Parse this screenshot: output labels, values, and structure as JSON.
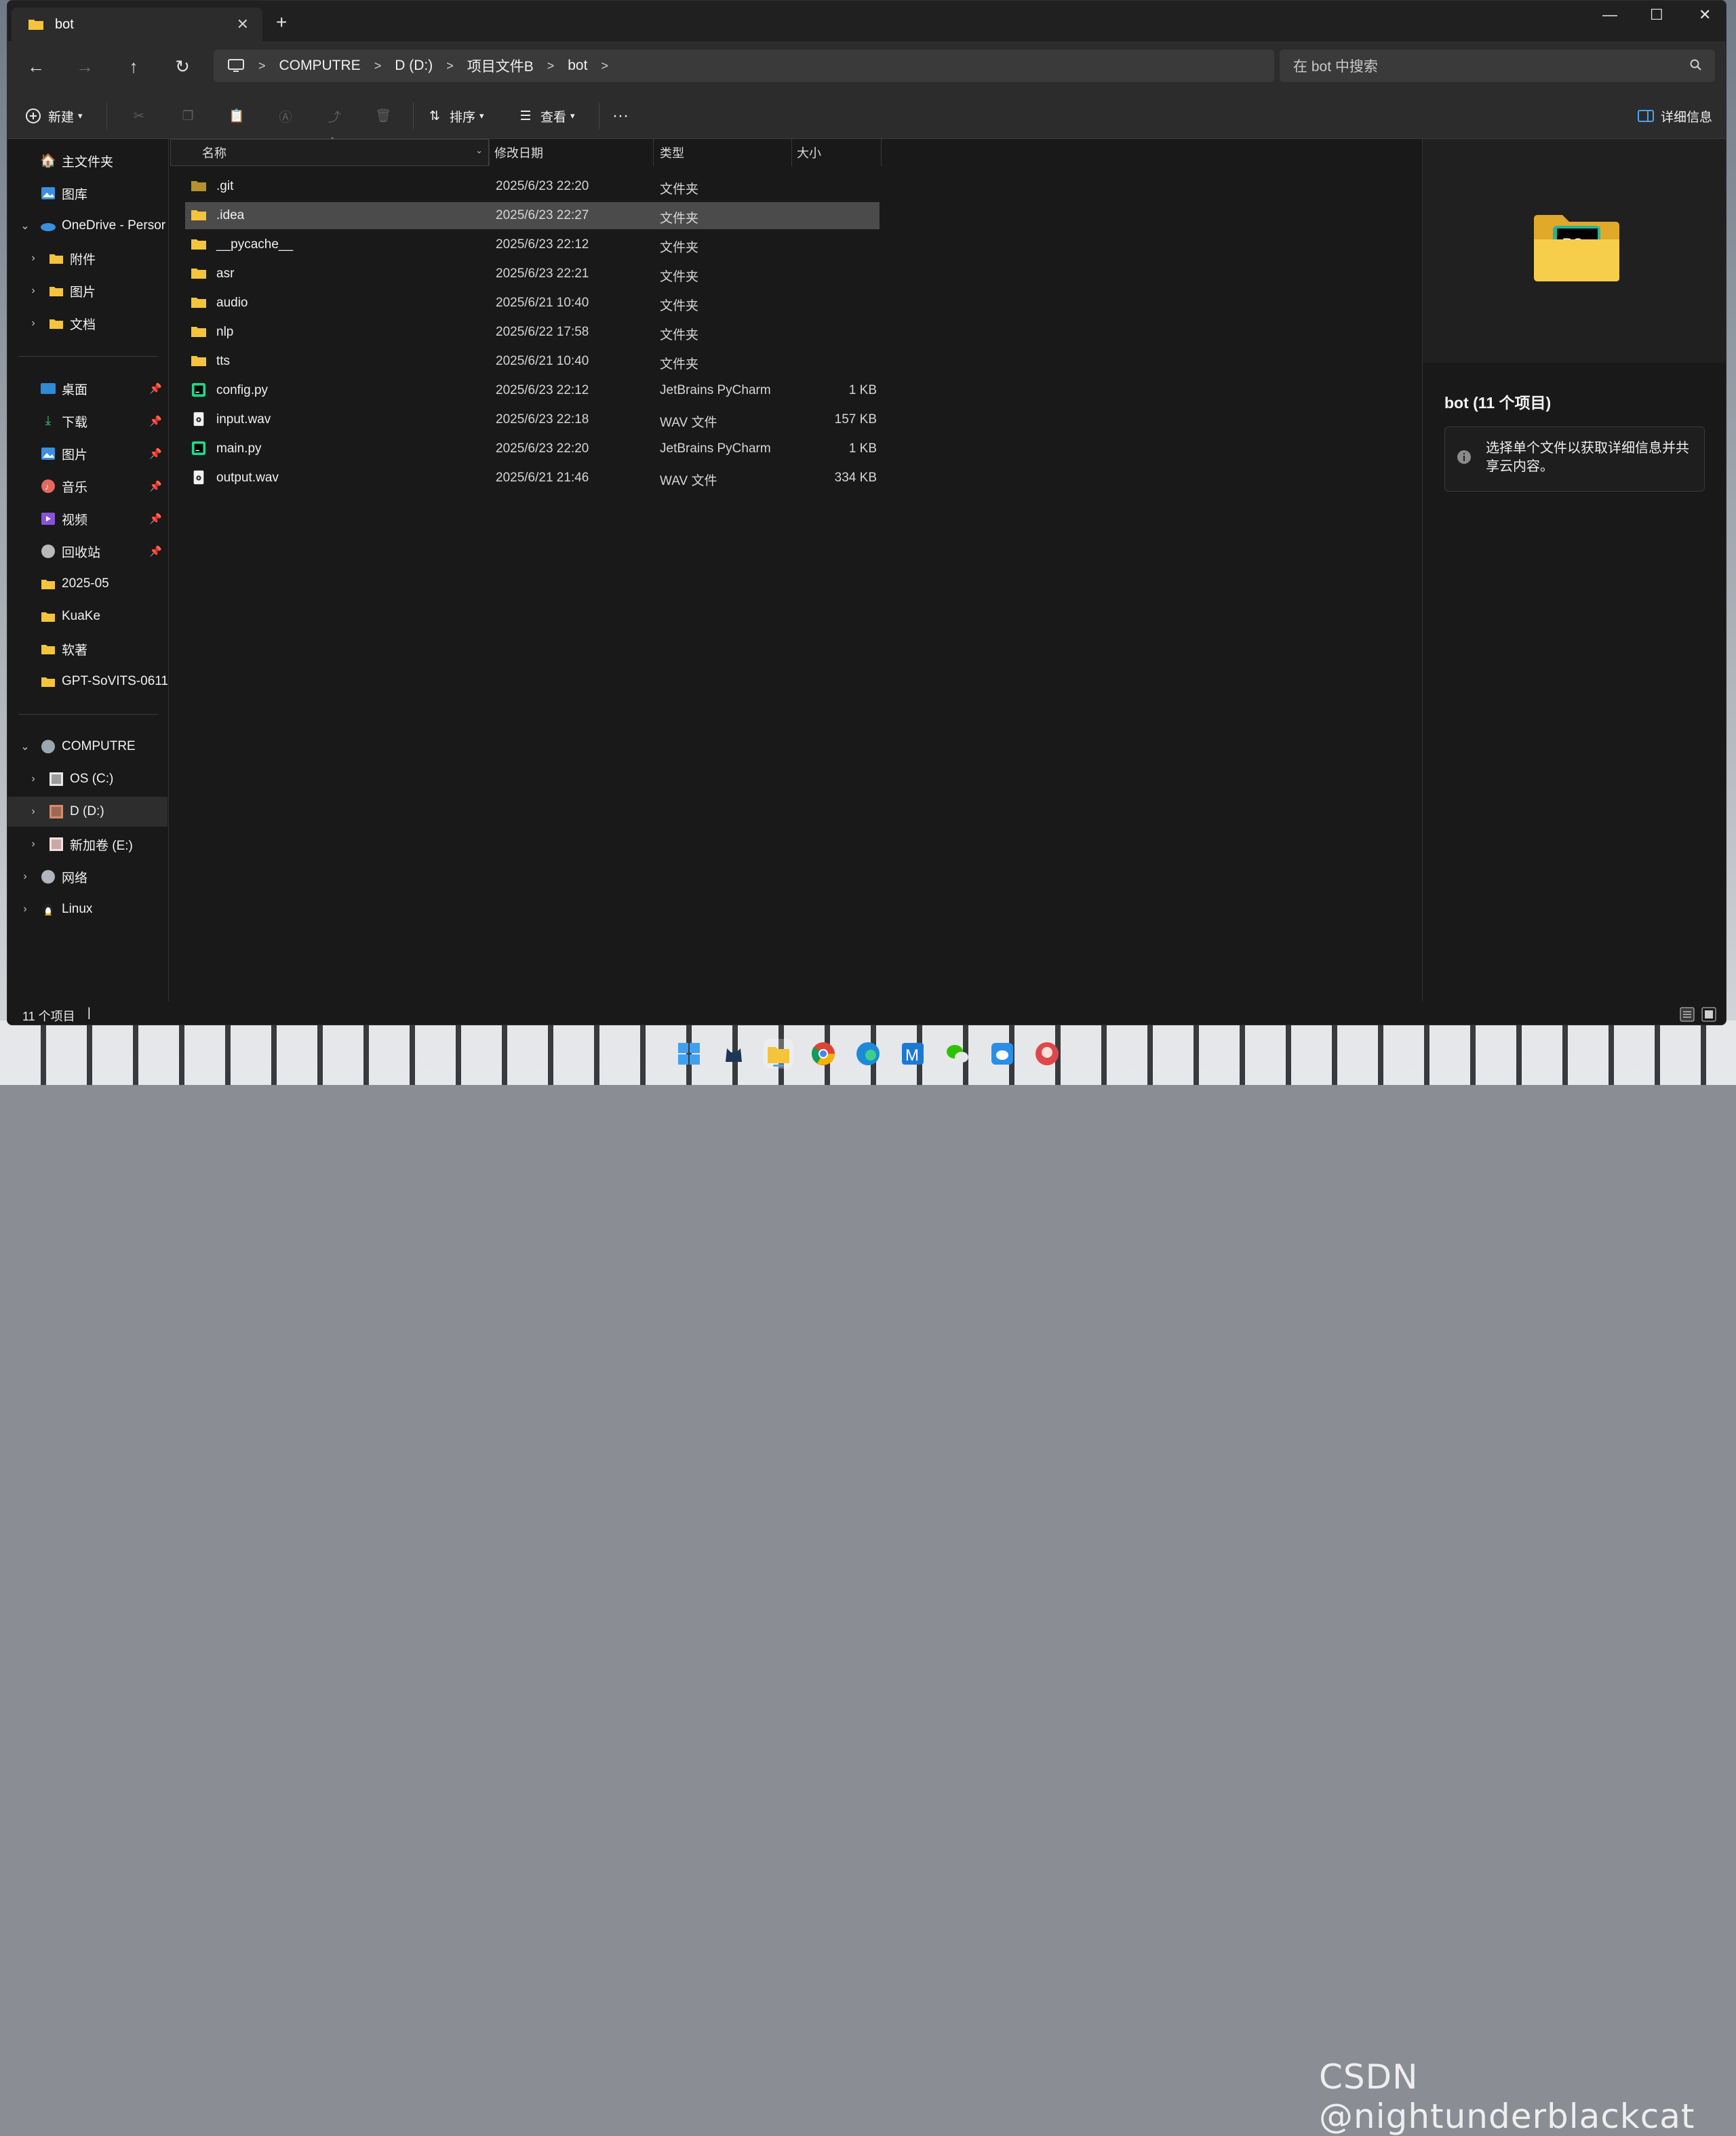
{
  "tab": {
    "title": "bot",
    "close": "✕",
    "new": "+"
  },
  "window_controls": {
    "minimize": "—",
    "maximize": "☐",
    "close": "✕"
  },
  "nav": {
    "back": "←",
    "forward": "→",
    "up": "↑",
    "refresh": "↻"
  },
  "breadcrumb": [
    "COMPUTRE",
    "D (D:)",
    "项目文件B",
    "bot"
  ],
  "search": {
    "placeholder": "在 bot 中搜索"
  },
  "toolbar": {
    "new_label": "新建",
    "sort_label": "排序",
    "view_label": "查看",
    "more": "···",
    "details_label": "详细信息"
  },
  "sidebar": {
    "home": "主文件夹",
    "gallery": "图库",
    "onedrive": "OneDrive - Persor",
    "onedrive_children": [
      "附件",
      "图片",
      "文档"
    ],
    "quick": [
      {
        "label": "桌面",
        "icon": "desktop-icon",
        "pinned": true
      },
      {
        "label": "下载",
        "icon": "download-icon",
        "pinned": true
      },
      {
        "label": "图片",
        "icon": "pictures-icon",
        "pinned": true
      },
      {
        "label": "音乐",
        "icon": "music-icon",
        "pinned": true
      },
      {
        "label": "视频",
        "icon": "video-icon",
        "pinned": true
      },
      {
        "label": "回收站",
        "icon": "recycle-bin-icon",
        "pinned": true
      },
      {
        "label": "2025-05",
        "icon": "folder-icon",
        "pinned": false
      },
      {
        "label": "KuaKe",
        "icon": "folder-icon",
        "pinned": false
      },
      {
        "label": "软著",
        "icon": "folder-icon",
        "pinned": false
      },
      {
        "label": "GPT-SoVITS-0611",
        "icon": "folder-icon",
        "pinned": false
      }
    ],
    "computer": "COMPUTRE",
    "drives": [
      "OS (C:)",
      "D (D:)",
      "新加卷 (E:)"
    ],
    "network": "网络",
    "linux": "Linux"
  },
  "columns": {
    "name": "名称",
    "date": "修改日期",
    "type": "类型",
    "size": "大小"
  },
  "files": [
    {
      "name": ".git",
      "date": "2025/6/23 22:20",
      "type": "文件夹",
      "size": "",
      "kind": "folder-dim"
    },
    {
      "name": ".idea",
      "date": "2025/6/23 22:27",
      "type": "文件夹",
      "size": "",
      "kind": "folder"
    },
    {
      "name": "__pycache__",
      "date": "2025/6/23 22:12",
      "type": "文件夹",
      "size": "",
      "kind": "folder"
    },
    {
      "name": "asr",
      "date": "2025/6/23 22:21",
      "type": "文件夹",
      "size": "",
      "kind": "folder"
    },
    {
      "name": "audio",
      "date": "2025/6/21 10:40",
      "type": "文件夹",
      "size": "",
      "kind": "folder"
    },
    {
      "name": "nlp",
      "date": "2025/6/22 17:58",
      "type": "文件夹",
      "size": "",
      "kind": "folder"
    },
    {
      "name": "tts",
      "date": "2025/6/21 10:40",
      "type": "文件夹",
      "size": "",
      "kind": "folder"
    },
    {
      "name": "config.py",
      "date": "2025/6/23 22:12",
      "type": "JetBrains PyCharm",
      "size": "1 KB",
      "kind": "pycharm"
    },
    {
      "name": "input.wav",
      "date": "2025/6/23 22:18",
      "type": "WAV 文件",
      "size": "157 KB",
      "kind": "wav"
    },
    {
      "name": "main.py",
      "date": "2025/6/23 22:20",
      "type": "JetBrains PyCharm",
      "size": "1 KB",
      "kind": "pycharm"
    },
    {
      "name": "output.wav",
      "date": "2025/6/21 21:46",
      "type": "WAV 文件",
      "size": "334 KB",
      "kind": "wav"
    }
  ],
  "selected_index": 1,
  "details": {
    "title": "bot (11 个项目)",
    "info": "选择单个文件以获取详细信息并共享云内容。",
    "preview_badge": "PC"
  },
  "status": {
    "count": "11 个项目"
  },
  "watermark": "CSDN @nightunderblackcat",
  "colors": {
    "window_bg": "#191919",
    "chrome_bg": "#2c2c2c",
    "folder": "#f4c43c",
    "selected_row": "#4b4b4b",
    "accent_blue": "#4aa3f0"
  }
}
